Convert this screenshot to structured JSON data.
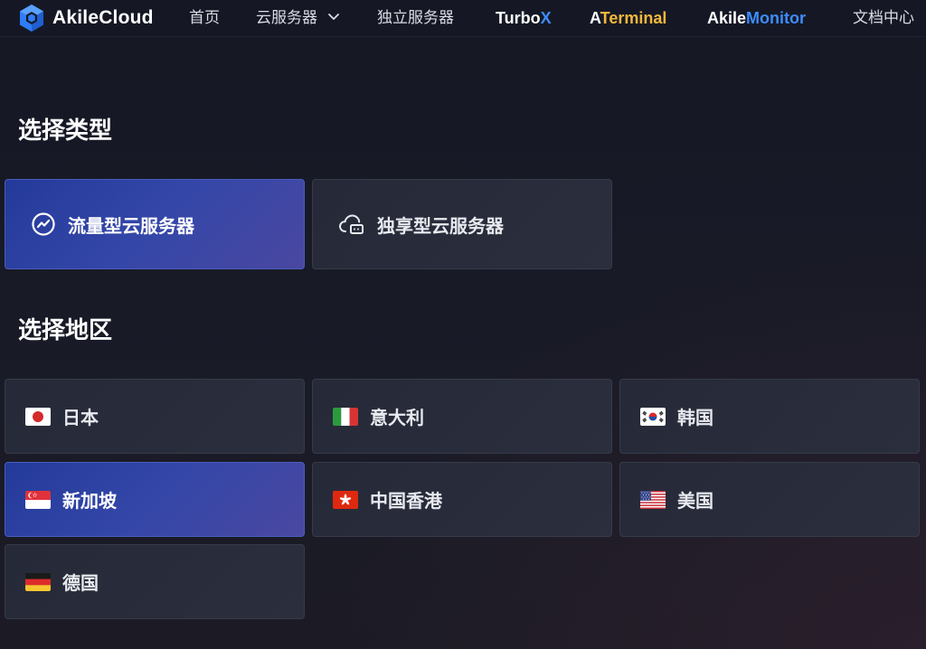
{
  "nav": {
    "brand": "AkileCloud",
    "items": {
      "home": "首页",
      "cloud": "云服务器",
      "dedicated": "独立服务器",
      "turbox_a": "Turbo",
      "turbox_b": "X",
      "aterminal_a": "A",
      "aterminal_b": "Terminal",
      "monitor_a": "Akile",
      "monitor_b": "Monitor",
      "docs": "文档中心"
    }
  },
  "sections": {
    "type_title": "选择类型",
    "region_title": "选择地区"
  },
  "types": [
    {
      "label": "流量型云服务器",
      "icon": "traffic-chart-icon",
      "selected": true
    },
    {
      "label": "独享型云服务器",
      "icon": "cloud-server-icon",
      "selected": false
    }
  ],
  "regions": [
    {
      "label": "日本",
      "flag": "japan-flag-icon",
      "selected": false
    },
    {
      "label": "意大利",
      "flag": "italy-flag-icon",
      "selected": false
    },
    {
      "label": "韩国",
      "flag": "korea-flag-icon",
      "selected": false
    },
    {
      "label": "新加坡",
      "flag": "singapore-flag-icon",
      "selected": true
    },
    {
      "label": "中国香港",
      "flag": "hongkong-flag-icon",
      "selected": false
    },
    {
      "label": "美国",
      "flag": "usa-flag-icon",
      "selected": false
    },
    {
      "label": "德国",
      "flag": "germany-flag-icon",
      "selected": false
    }
  ],
  "colors": {
    "accent_blue": "#3d8cff",
    "accent_gold": "#f5b83d",
    "selected_card": "#3447a8",
    "card_bg": "#2b2e3c"
  }
}
